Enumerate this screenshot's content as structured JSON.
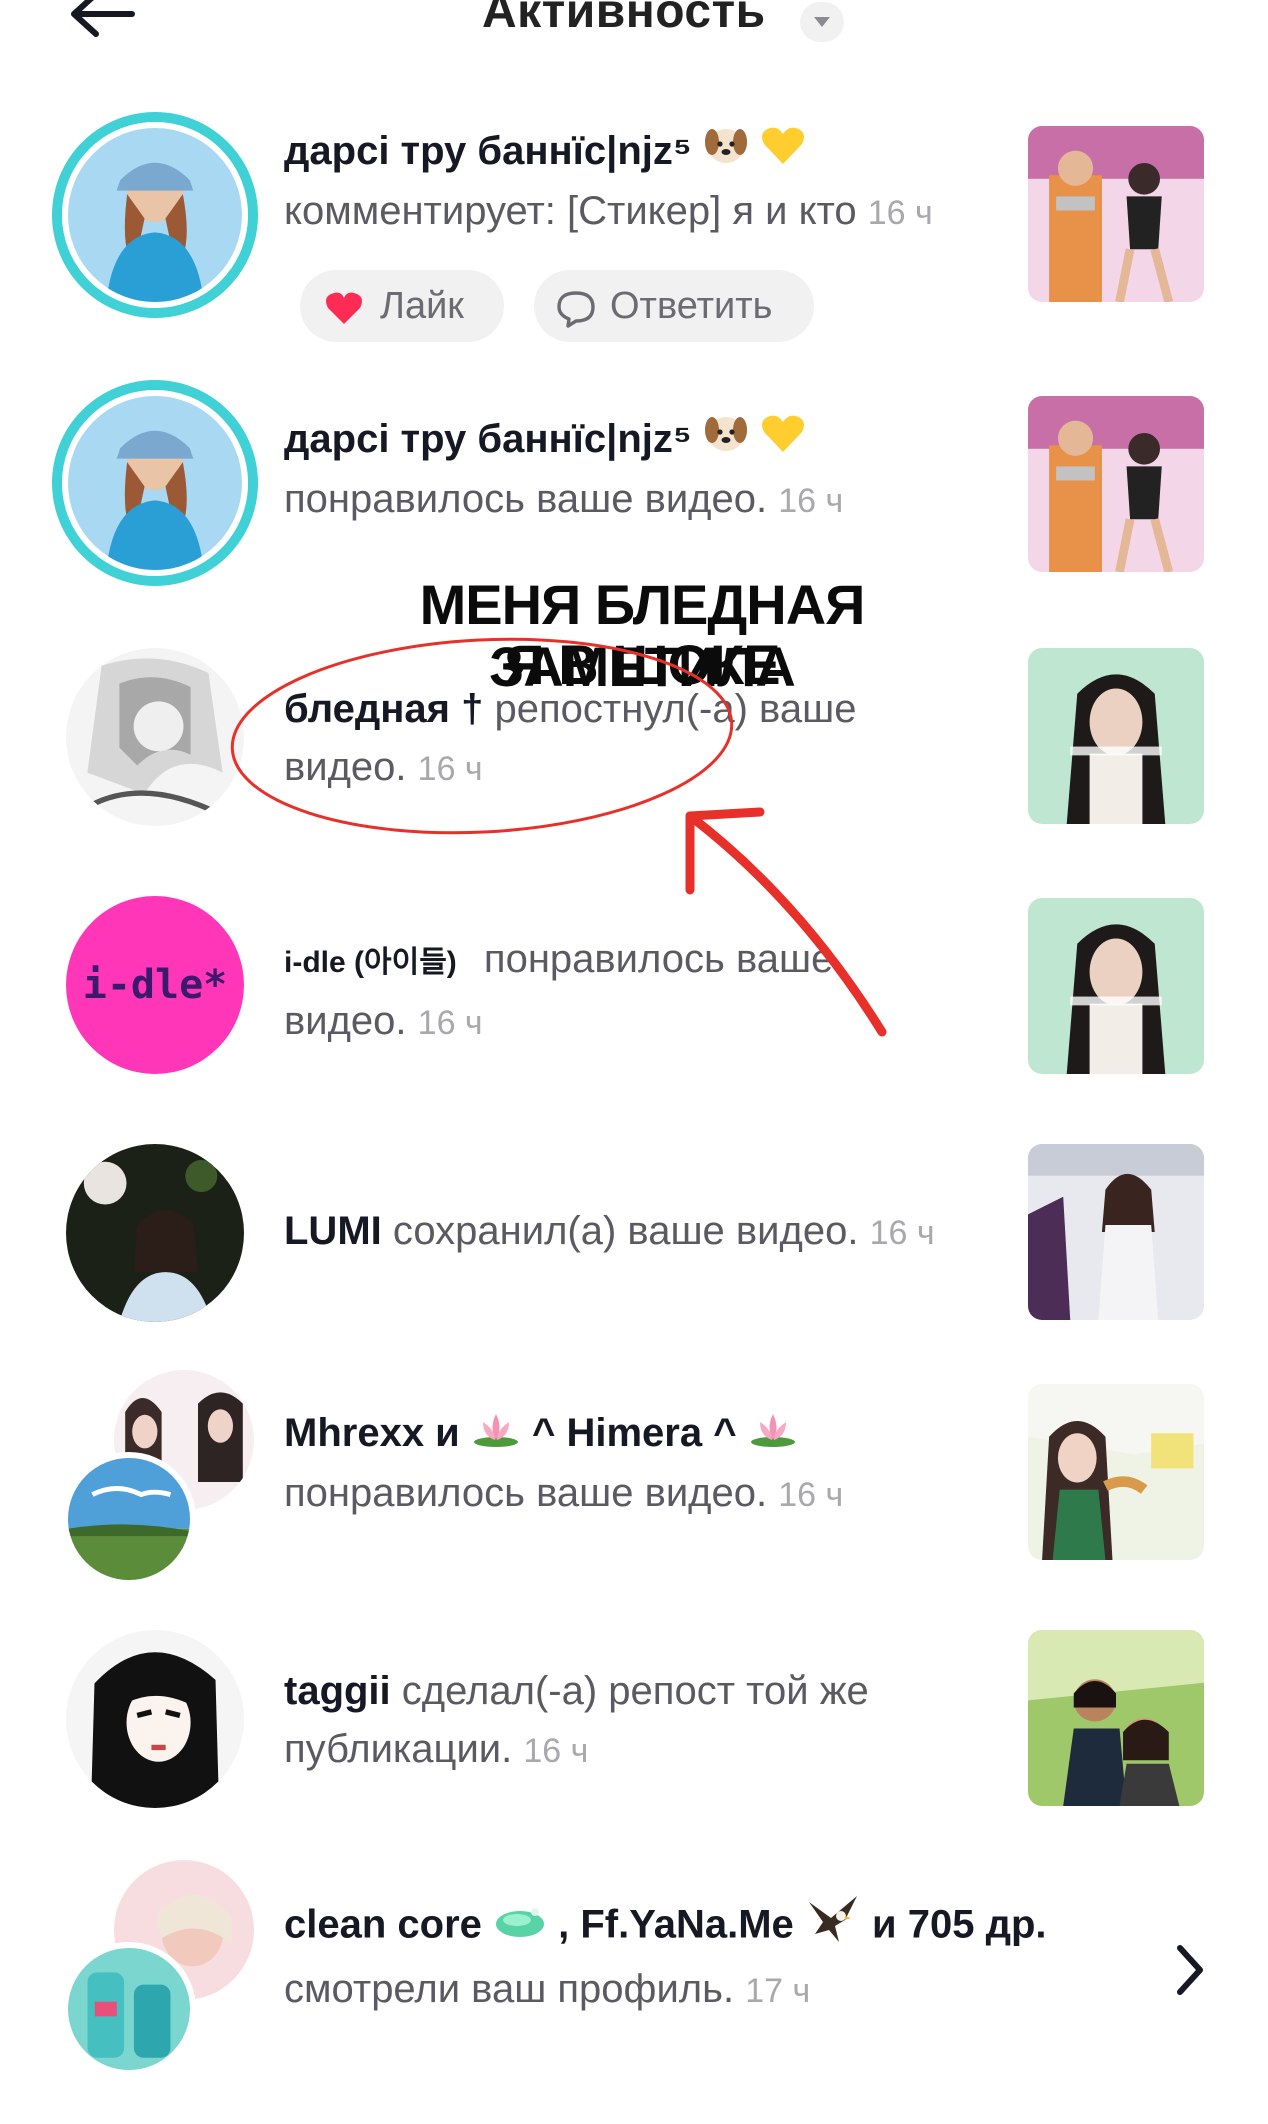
{
  "header": {
    "title": "Активность",
    "back_icon": "arrow-left-icon",
    "dropdown_icon": "caret-down-icon"
  },
  "colors": {
    "story_ring": "#3fd1d5",
    "like_heart": "#fe2c55",
    "annotation_red": "#e8302a"
  },
  "activities": [
    {
      "username": "дарсі тру баннїс|njz⁵",
      "emojis": [
        "dog-face-emoji",
        "yellow-heart-emoji"
      ],
      "action": "комментирует: [Стикер] я и кто",
      "time": "16 ч",
      "like_label": "Лайк",
      "reply_label": "Ответить"
    },
    {
      "username": "дарсі тру баннїс|njz⁵",
      "emojis": [
        "dog-face-emoji",
        "yellow-heart-emoji"
      ],
      "action": "понравилось ваше видео.",
      "time": "16 ч"
    },
    {
      "username": "бледная †",
      "action_line1": "репостнул(-а) ваше",
      "action_line2": "видео.",
      "time": "16 ч"
    },
    {
      "username": "i-dle (아이들)",
      "action_line1": "понравилось ваше",
      "action_line2": "видео.",
      "time": "16 ч",
      "avatar_text": "i-dle*"
    },
    {
      "username": "LUMI",
      "action": "сохранил(а) ваше видео.",
      "time": "16 ч"
    },
    {
      "username_a": "Mhrexx и",
      "username_b": "^ Himera ^",
      "emojis": [
        "lotus-emoji",
        "lotus-emoji"
      ],
      "action": "понравилось ваше видео.",
      "time": "16 ч"
    },
    {
      "username": "taggii",
      "action_line1": "сделал(-а) репост той же",
      "action_line2": "публикации.",
      "time": "16 ч"
    },
    {
      "username_a": "clean core",
      "username_b": ", Ff.YaNa.Me",
      "username_c": "и 705 др.",
      "emojis": [
        "soap-emoji",
        "eagle-emoji"
      ],
      "action": "смотрели ваш профиль.",
      "time": "17 ч"
    }
  ],
  "annotation": {
    "line1": "МЕНЯ БЛЕДНАЯ ЗАМЕТИЛА",
    "line2": "Я В ШОКЕ"
  }
}
